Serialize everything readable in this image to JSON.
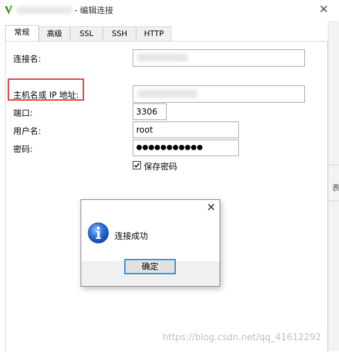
{
  "window": {
    "title": "- 编辑连接",
    "close_symbol": "✕"
  },
  "tabs": [
    {
      "label": "常规",
      "active": true
    },
    {
      "label": "高级",
      "active": false
    },
    {
      "label": "SSL",
      "active": false
    },
    {
      "label": "SSH",
      "active": false
    },
    {
      "label": "HTTP",
      "active": false
    }
  ],
  "form": {
    "connection_name_label": "连接名:",
    "connection_name_value": "",
    "host_label": "主机名或 IP 地址:",
    "host_value": "",
    "port_label": "端口:",
    "port_value": "3306",
    "username_label": "用户名:",
    "username_value": "root",
    "password_label": "密码:",
    "password_value": "●●●●●●●●●●●",
    "save_password_label": "保存密码",
    "save_password_checked": true
  },
  "dialog": {
    "close_symbol": "✕",
    "message": "连接成功",
    "ok_label": "确定",
    "icon": "info-icon"
  },
  "background": {
    "edge_char": "表"
  },
  "watermark": "https://blog.csdn.net/qq_41612292",
  "colors": {
    "highlight_border": "#e23b3b",
    "button_focus": "#0078d7",
    "info_icon_blue": "#2a6fd6"
  }
}
